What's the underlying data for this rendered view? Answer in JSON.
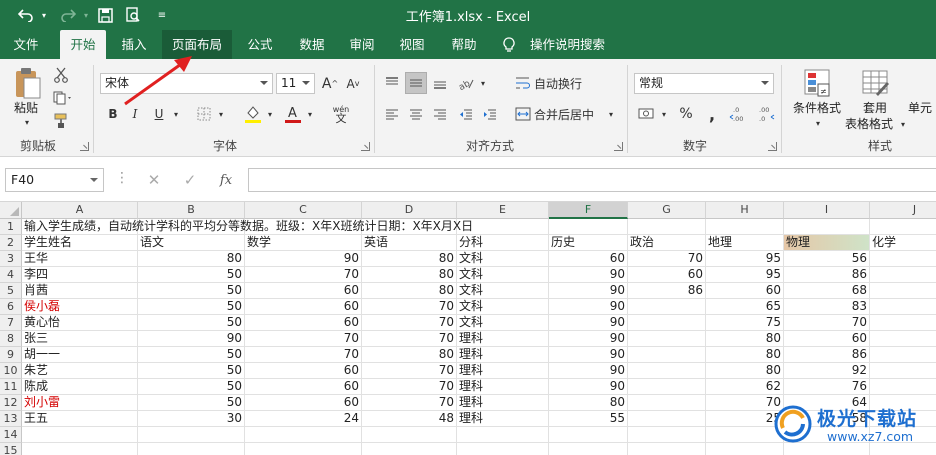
{
  "window": {
    "title": "工作簿1.xlsx  -  Excel"
  },
  "quick_access": {
    "undo_icon": "undo-icon",
    "redo_icon": "redo-icon",
    "save_icon": "save-icon",
    "print_preview_icon": "print-preview-icon",
    "customize_icon": "customize-qat-icon"
  },
  "tabs": [
    {
      "label": "文件"
    },
    {
      "label": "开始"
    },
    {
      "label": "插入"
    },
    {
      "label": "页面布局"
    },
    {
      "label": "公式"
    },
    {
      "label": "数据"
    },
    {
      "label": "审阅"
    },
    {
      "label": "视图"
    },
    {
      "label": "帮助"
    }
  ],
  "tell_me": "操作说明搜索",
  "ribbon": {
    "clipboard": {
      "paste_label": "粘贴",
      "group_label": "剪贴板"
    },
    "font": {
      "font_name": "宋体",
      "font_size": "11",
      "bold": "B",
      "italic": "I",
      "underline": "U",
      "phonetic": "wén",
      "group_label": "字体"
    },
    "alignment": {
      "wrap_text": "自动换行",
      "merge_center": "合并后居中",
      "group_label": "对齐方式"
    },
    "number": {
      "format": "常规",
      "group_label": "数字"
    },
    "styles": {
      "conditional_format": "条件格式",
      "table_format_1": "套用",
      "table_format_2": "表格格式",
      "cell_styles": "单元",
      "group_label": "样式"
    }
  },
  "formula_bar": {
    "name_box": "F40",
    "fx": "fx",
    "formula": ""
  },
  "sheet": {
    "columns": [
      "A",
      "B",
      "C",
      "D",
      "E",
      "F",
      "G",
      "H",
      "I",
      "J"
    ],
    "selected_column": "F",
    "rows": [
      1,
      2,
      3,
      4,
      5,
      6,
      7,
      8,
      9,
      10,
      11,
      12,
      13,
      14,
      15
    ],
    "row1_text": "输入学生成绩，自动统计学科的平均分等数据。班级：X年X班统计日期：X年X月X日",
    "headers": [
      "学生姓名",
      "语文",
      "数学",
      "英语",
      "分科",
      "历史",
      "政治",
      "地理",
      "物理",
      "化学"
    ],
    "data": [
      {
        "name": "王华",
        "yuwen": "80",
        "shuxue": "90",
        "yingyu": "80",
        "fenke": "文科",
        "lishi": "60",
        "zhengzhi": "70",
        "dili": "95",
        "wuli": "56",
        "red": false
      },
      {
        "name": "李四",
        "yuwen": "50",
        "shuxue": "70",
        "yingyu": "80",
        "fenke": "文科",
        "lishi": "90",
        "zhengzhi": "60",
        "dili": "95",
        "wuli": "86",
        "red": false
      },
      {
        "name": "肖茜",
        "yuwen": "50",
        "shuxue": "60",
        "yingyu": "80",
        "fenke": "文科",
        "lishi": "90",
        "zhengzhi": "86",
        "dili": "60",
        "wuli": "68",
        "red": false
      },
      {
        "name": "侯小磊",
        "yuwen": "50",
        "shuxue": "60",
        "yingyu": "70",
        "fenke": "文科",
        "lishi": "90",
        "zhengzhi": "",
        "dili": "65",
        "wuli": "83",
        "red": true
      },
      {
        "name": "黄心怡",
        "yuwen": "50",
        "shuxue": "60",
        "yingyu": "70",
        "fenke": "文科",
        "lishi": "90",
        "zhengzhi": "",
        "dili": "75",
        "wuli": "70",
        "red": false
      },
      {
        "name": "张三",
        "yuwen": "90",
        "shuxue": "70",
        "yingyu": "70",
        "fenke": "理科",
        "lishi": "90",
        "zhengzhi": "",
        "dili": "80",
        "wuli": "60",
        "red": false
      },
      {
        "name": "胡一一",
        "yuwen": "50",
        "shuxue": "70",
        "yingyu": "80",
        "fenke": "理科",
        "lishi": "90",
        "zhengzhi": "",
        "dili": "80",
        "wuli": "86",
        "red": false
      },
      {
        "name": "朱艺",
        "yuwen": "50",
        "shuxue": "60",
        "yingyu": "70",
        "fenke": "理科",
        "lishi": "90",
        "zhengzhi": "",
        "dili": "80",
        "wuli": "92",
        "red": false
      },
      {
        "name": "陈成",
        "yuwen": "50",
        "shuxue": "60",
        "yingyu": "70",
        "fenke": "理科",
        "lishi": "90",
        "zhengzhi": "",
        "dili": "62",
        "wuli": "76",
        "red": false
      },
      {
        "name": "刘小雷",
        "yuwen": "50",
        "shuxue": "60",
        "yingyu": "70",
        "fenke": "理科",
        "lishi": "80",
        "zhengzhi": "",
        "dili": "70",
        "wuli": "64",
        "red": true
      },
      {
        "name": "王五",
        "yuwen": "30",
        "shuxue": "24",
        "yingyu": "48",
        "fenke": "理科",
        "lishi": "55",
        "zhengzhi": "",
        "dili": "25",
        "wuli": "58",
        "red": false
      }
    ]
  },
  "watermark": {
    "name": "极光下载站",
    "url": "www.xz7.com"
  },
  "colors": {
    "excel_green": "#217346",
    "annotation_red": "#e02020",
    "red_text": "#d40000"
  }
}
